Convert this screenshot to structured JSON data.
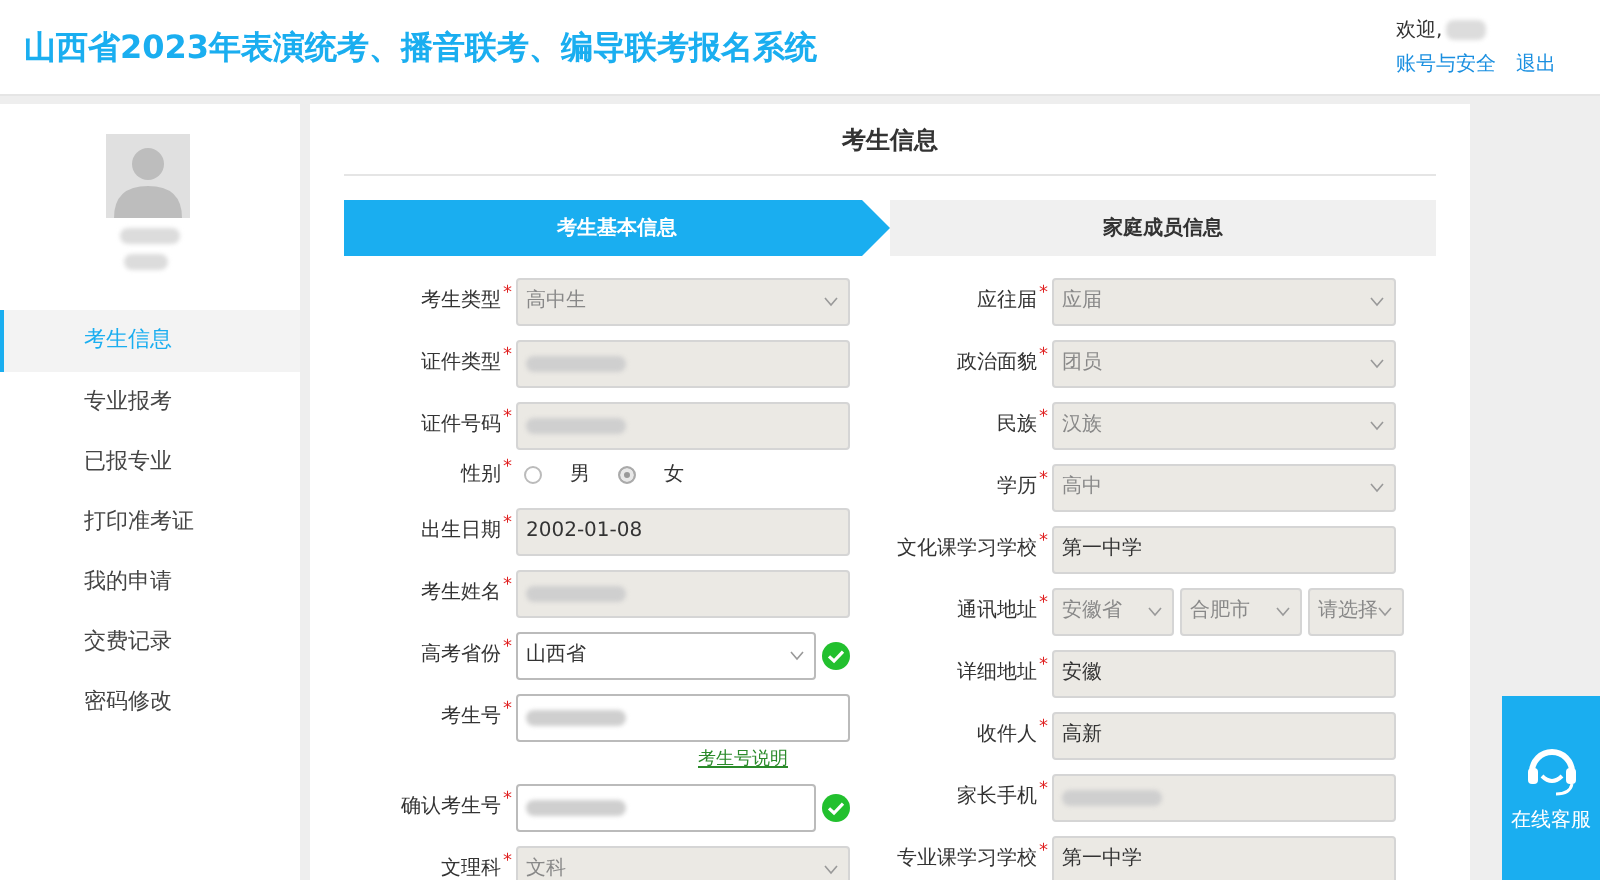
{
  "header": {
    "title": "山西省2023年表演统考、播音联考、编导联考报名系统",
    "welcome": "欢迎,",
    "links": [
      "账号与安全",
      "退出"
    ]
  },
  "sidebar": {
    "items": [
      {
        "label": "考生信息",
        "selected": true
      },
      {
        "label": "专业报考",
        "selected": false
      },
      {
        "label": "已报专业",
        "selected": false
      },
      {
        "label": "打印准考证",
        "selected": false
      },
      {
        "label": "我的申请",
        "selected": false
      },
      {
        "label": "交费记录",
        "selected": false
      },
      {
        "label": "密码修改",
        "selected": false
      }
    ]
  },
  "page_title": "考生信息",
  "steps": [
    {
      "label": "考生基本信息",
      "selected": true
    },
    {
      "label": "家庭成员信息",
      "selected": false
    }
  ],
  "left_fields": [
    {
      "kind": "select",
      "label": "考生类型",
      "required_mark": "*",
      "value": "高中生",
      "disabled": true,
      "valid": false
    },
    {
      "kind": "text",
      "label": "证件类型",
      "required_mark": "*",
      "blurred": true,
      "disabled": true,
      "valid": false
    },
    {
      "kind": "text",
      "label": "证件号码",
      "required_mark": "*",
      "blurred": true,
      "disabled": true,
      "valid": false
    },
    {
      "kind": "radio",
      "label": "性别",
      "required_mark": "*",
      "options": [
        {
          "label": "男",
          "selected": false
        },
        {
          "label": "女",
          "selected": true
        }
      ]
    },
    {
      "kind": "text",
      "label": "出生日期",
      "required_mark": "*",
      "value": "2002-01-08",
      "disabled": true,
      "valid": false
    },
    {
      "kind": "text",
      "label": "考生姓名",
      "required_mark": "*",
      "blurred": true,
      "disabled": true,
      "valid": false
    },
    {
      "kind": "select",
      "label": "高考省份",
      "required_mark": "*",
      "value": "山西省",
      "disabled": false,
      "valid": true
    },
    {
      "kind": "text",
      "label": "考生号",
      "required_mark": "*",
      "blurred": true,
      "disabled": false,
      "valid": false
    },
    {
      "kind": "link",
      "label": "考生号说明"
    },
    {
      "kind": "text",
      "label": "确认考生号",
      "required_mark": "*",
      "blurred": true,
      "disabled": false,
      "valid": true
    },
    {
      "kind": "select",
      "label": "文理科",
      "required_mark": "*",
      "value": "文科",
      "disabled": true,
      "valid": false
    }
  ],
  "right_fields": [
    {
      "kind": "select",
      "label": "应往届",
      "required_mark": "*",
      "value": "应届",
      "disabled": true
    },
    {
      "kind": "select",
      "label": "政治面貌",
      "required_mark": "*",
      "value": "团员",
      "disabled": true
    },
    {
      "kind": "select",
      "label": "民族",
      "required_mark": "*",
      "value": "汉族",
      "disabled": true
    },
    {
      "kind": "select",
      "label": "学历",
      "required_mark": "*",
      "value": "高中",
      "disabled": true
    },
    {
      "kind": "text",
      "label": "文化课学习学校",
      "required_mark": "*",
      "value": "第一中学",
      "disabled": true
    },
    {
      "kind": "address",
      "label": "通讯地址",
      "required_mark": "*",
      "parts": [
        "安徽省",
        "合肥市",
        "请选择"
      ],
      "disabled": true
    },
    {
      "kind": "text",
      "label": "详细地址",
      "required_mark": "*",
      "value": "安徽",
      "disabled": true
    },
    {
      "kind": "text",
      "label": "收件人",
      "required_mark": "*",
      "value": "高新",
      "disabled": true
    },
    {
      "kind": "text",
      "label": "家长手机",
      "required_mark": "*",
      "blurred": true,
      "disabled": true
    },
    {
      "kind": "text",
      "label": "专业课学习学校",
      "required_mark": "*",
      "value": "第一中学",
      "disabled": true
    }
  ],
  "service_button": "在线客服"
}
